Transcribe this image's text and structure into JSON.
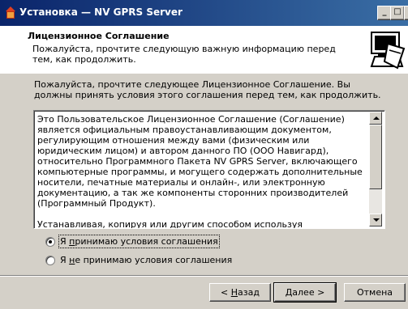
{
  "window": {
    "title": "Установка — NV GPRS Server",
    "controls": {
      "minimize": "_",
      "maximize": "□",
      "close": "×"
    }
  },
  "header": {
    "title": "Лицензионное Соглашение",
    "description": "Пожалуйста, прочтите следующую важную информацию перед тем, как продолжить.",
    "image_icon": "monitor-box-setup-icon"
  },
  "intro": "Пожалуйста, прочтите следующее Лицензионное Соглашение. Вы должны принять условия этого соглашения перед тем, как продолжить.",
  "license": {
    "paragraphs": [
      "Это Пользовательское Лицензионное Соглашение (Соглашение) является официальным правоустанавливающим документом, регулирующим отношения между вами (физическим или юридическим лицом) и автором данного ПО (ООО Навигард), относительно Программного Пакета NV GPRS Server, включающего компьютерные программы, и могущего содержать дополнительные носители, печатные материалы и онлайн-, или электронную документацию, а так же компоненты сторонних производителей (Программный Продукт).",
      "Устанавливая, копируя или другим способом используя Программный Продукт, вы тем самым соглашаетесь выполнять условия данного"
    ]
  },
  "options": {
    "accept": {
      "prefix": "Я ",
      "accel": "п",
      "suffix": "ринимаю условия соглашения",
      "selected": true
    },
    "decline": {
      "prefix": "Я ",
      "accel": "н",
      "suffix": "е принимаю условия соглашения",
      "selected": false
    }
  },
  "buttons": {
    "back": {
      "prefix": "< ",
      "accel": "Н",
      "suffix": "азад"
    },
    "next": {
      "prefix": "",
      "accel": "Д",
      "suffix": "алее >"
    },
    "cancel": "Отмена"
  },
  "colors": {
    "title_start": "#0a246a",
    "title_end": "#3a6ea5",
    "face": "#d4d0c8"
  }
}
